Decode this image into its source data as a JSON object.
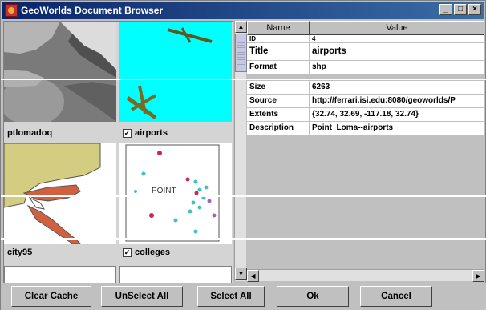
{
  "window": {
    "title": "GeoWorlds Document Browser",
    "minimize_glyph": "_",
    "maximize_glyph": "□",
    "close_glyph": "×"
  },
  "thumbnails": [
    {
      "label": "ptlomadoq",
      "checked": false,
      "image": "aerial-photo"
    },
    {
      "label": "airports",
      "checked": true,
      "image": "airport-map"
    },
    {
      "label": "city95",
      "checked": false,
      "image": "coastline-map"
    },
    {
      "label": "colleges",
      "checked": true,
      "image": "point-map"
    }
  ],
  "thumbnail_map_text": "POINT",
  "check_glyph": "✓",
  "properties": {
    "headers": {
      "name": "Name",
      "value": "Value"
    },
    "rows": [
      {
        "name": "ID",
        "value": "4"
      },
      {
        "name": "Title",
        "value": "airports"
      },
      {
        "name": "Format",
        "value": "shp"
      },
      {
        "name": "Size",
        "value": "6263"
      },
      {
        "name": "Source",
        "value": "http://ferrari.isi.edu:8080/geoworlds/P"
      },
      {
        "name": "Extents",
        "value": "{32.74, 32.69, -117.18, 32.74}"
      },
      {
        "name": "Description",
        "value": "Point_Loma--airports"
      }
    ]
  },
  "scroll_glyphs": {
    "up": "▲",
    "down": "▼",
    "left": "◀",
    "right": "▶"
  },
  "buttons": {
    "clear_cache": "Clear Cache",
    "unselect_all": "UnSelect All",
    "select_all": "Select All",
    "ok": "Ok",
    "cancel": "Cancel"
  },
  "colors": {
    "titlebar": "#0a246a",
    "cyan_bg": "#00ffff",
    "map_land": "#d4cc80",
    "map_red": "#d06040"
  }
}
